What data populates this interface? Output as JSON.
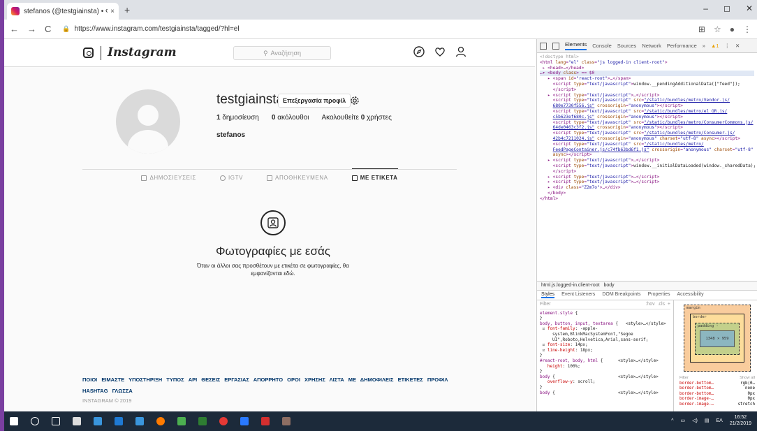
{
  "browser": {
    "tab_title": "stefanos (@testgiainsta) • Φωτο",
    "tab_close": "×",
    "new_tab": "+",
    "url": "https://www.instagram.com/testgiainsta/tagged/?hl=el",
    "win_min": "–",
    "win_max": "◻",
    "win_close": "✕"
  },
  "instagram": {
    "wordmark": "Instagram",
    "search_placeholder": "Αναζήτηση",
    "username": "testgiainsta",
    "edit_profile": "Επεξεργασία προφίλ",
    "stats": {
      "posts_num": "1",
      "posts_label": "δημοσίευση",
      "followers_num": "0",
      "followers_label": "ακόλουθοι",
      "following_label": "Ακολουθείτε",
      "following_num": "0",
      "following_suffix": "χρήστες"
    },
    "fullname": "stefanos",
    "tabs": [
      {
        "label": "ΔΗΜΟΣΙΕΥΣΕΙΣ",
        "icon": "grid-icon"
      },
      {
        "label": "IGTV",
        "icon": "igtv-icon"
      },
      {
        "label": "ΑΠΟΘΗΚΕΥΜΕΝΑ",
        "icon": "bookmark-icon"
      },
      {
        "label": "ΜΕ ΕΤΙΚΕΤΑ",
        "icon": "tag-icon"
      }
    ],
    "empty_title": "Φωτογραφίες με εσάς",
    "empty_text": "Όταν οι άλλοι σας προσθέτουν με ετικέτα σε φωτογραφίες, θα εμφανίζονται εδώ.",
    "footer_links": "ΠΟΙΟΙ ΕΙΜΑΣΤΕ   ΥΠΟΣΤΗΡΙΞΗ   ΤΥΠΟΣ   API   ΘΕΣΕΙΣ ΕΡΓΑΣΙΑΣ   ΑΠΟΡΡΗΤΟ   ΟΡΟΙ ΧΡΗΣΗΣ   ΛΙΣΤΑ ΜΕ ΔΗΜΟΦΙΛΕΙΣ ΕΤΙΚΕΤΕΣ   ΠΡΟΦΙΛ   HASHTAG   ΓΛΩΣΣΑ",
    "copyright": "INSTAGRAM © 2019"
  },
  "devtools": {
    "tabs": [
      "Elements",
      "Console",
      "Sources",
      "Network",
      "Performance",
      "»"
    ],
    "warning_count": "▲1",
    "menu": "⋮",
    "close": "✕",
    "breadcrumb_html": "html.js.logged-in.client-root",
    "breadcrumb_body": "body",
    "style_tabs": [
      "Styles",
      "Event Listeners",
      "DOM Breakpoints",
      "Properties",
      "Accessibility"
    ],
    "filter": "Filter",
    "filter_right": ":hov  .cls  +",
    "box_margin": "margin",
    "box_border": "border",
    "box_padding": "padding -",
    "box_content": "1348 × 959",
    "computed_filter": "Filter",
    "show_all": "Show all",
    "computed_rows": [
      {
        "name": "border-bottom…",
        "value": "rgb(0…"
      },
      {
        "name": "border-bottom…",
        "value": "none"
      },
      {
        "name": "border-bottom…",
        "value": "0px"
      },
      {
        "name": "border-image-…",
        "value": "0px"
      },
      {
        "name": "border-image-…",
        "value": "stretch"
      }
    ]
  },
  "taskbar": {
    "lang": "ΕΛ",
    "time": "16:52",
    "date": "21/2/2019"
  }
}
